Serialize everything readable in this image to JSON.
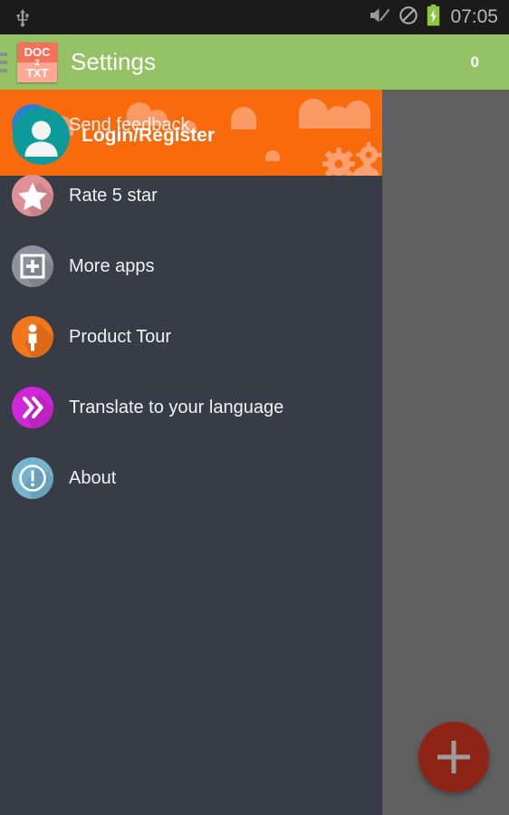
{
  "status_bar": {
    "usb_icon": "usb-icon",
    "mute_icon": "volume-muted-icon",
    "dnd_icon": "do-not-disturb-icon",
    "battery_icon": "battery-charging-icon",
    "clock": "07:05",
    "background": "#1b1b1b",
    "text_color": "#b8b8b8"
  },
  "action_bar": {
    "menu_icon": "hamburger-menu-icon",
    "app_icon": {
      "name": "doc2txt-app-icon",
      "line1": "DOC",
      "line2": "2",
      "line3": "TXT"
    },
    "title": "Settings",
    "count": "0",
    "background": "#94c265"
  },
  "drawer": {
    "background": "#373c46",
    "header": {
      "background": "#f96a0d",
      "avatar_icon": "user-avatar-icon",
      "avatar_color": "#0c9a9a",
      "label": "Login/Register",
      "decorations": [
        "cloud-shape",
        "gear-shape"
      ]
    },
    "items": [
      {
        "label": "Send feedback",
        "icon": "envelope-icon",
        "color": "#2a7fd4"
      },
      {
        "label": "Rate 5 star",
        "icon": "star-icon",
        "color": "#e09197"
      },
      {
        "label": "More apps",
        "icon": "add-box-icon",
        "color": "#8d929c"
      },
      {
        "label": "Product Tour",
        "icon": "person-standing-icon",
        "color": "#f4761b"
      },
      {
        "label": "Translate to your language",
        "icon": "double-chevron-right-icon",
        "color": "#d227d9"
      },
      {
        "label": "About",
        "icon": "info-exclamation-icon",
        "color": "#74b4cd"
      }
    ]
  },
  "content_panel": {
    "scrim_color": "#5f5f5f",
    "fab": {
      "icon": "plus-icon",
      "color": "#8e2416"
    }
  }
}
